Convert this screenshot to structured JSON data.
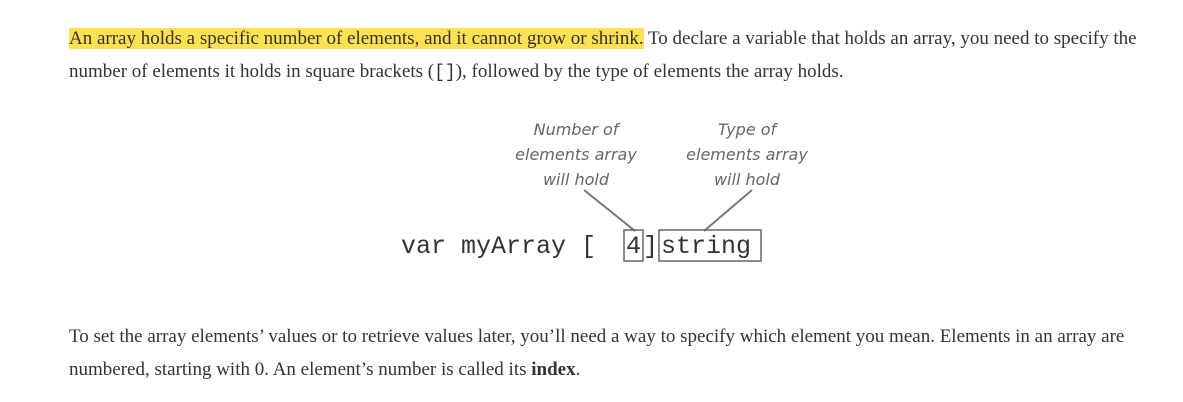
{
  "paragraph1": {
    "highlight": "An array holds a specific number of elements, and it cannot grow or shrink.",
    "text_a": " To declare a variable that holds an array, you need to specify the number of elements it holds in square brackets (",
    "code": "[]",
    "text_b": "), followed by the type of elements the array holds."
  },
  "diagram": {
    "left_annotation": [
      "Number of",
      "elements array",
      "will hold"
    ],
    "right_annotation": [
      "Type of",
      "elements array",
      "will hold"
    ],
    "code_prefix": "var myArray [",
    "code_length": "4",
    "code_bracket_close": "]",
    "code_type": "string"
  },
  "paragraph2": {
    "text_a": "To set the array elements’ values or to retrieve values later, you’ll need a way to specify which element you mean. Elements in an array are numbered, starting with 0. An element’s number is called its ",
    "bold": "index",
    "text_b": "."
  }
}
